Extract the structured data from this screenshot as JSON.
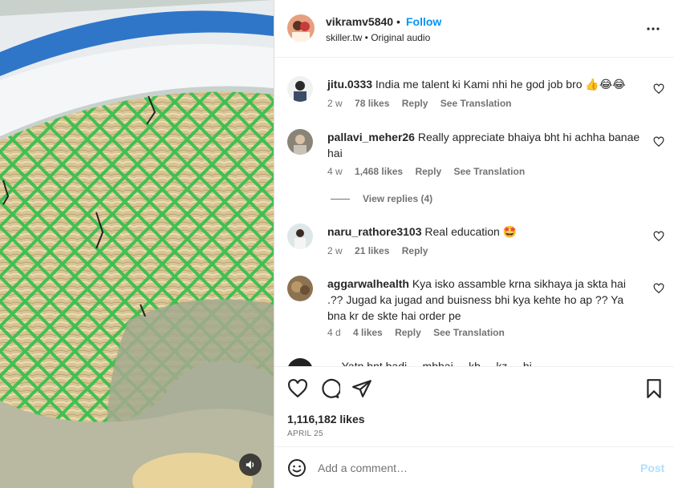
{
  "post": {
    "username": "vikramv5840",
    "separator": "•",
    "follow_label": "Follow",
    "subtitle": "skiller.tw • Original audio"
  },
  "comments": [
    {
      "username": "jitu.0333",
      "text": "India me talent ki Kami nhi he god job bro 👍😂😂",
      "time": "2 w",
      "likes": "78 likes",
      "reply": "Reply",
      "translate": "See Translation"
    },
    {
      "username": "pallavi_meher26",
      "text": "Really appreciate bhaiya bht hi achha banae hai",
      "time": "4 w",
      "likes": "1,468 likes",
      "reply": "Reply",
      "translate": "See Translation",
      "view_replies": "View replies (4)"
    },
    {
      "username": "naru_rathore3103",
      "text": "Real education 🤩",
      "time": "2 w",
      "likes": "21 likes",
      "reply": "Reply"
    },
    {
      "username": "aggarwalhealth",
      "text": "Kya isko assamble krna sikhaya ja skta hai .?? Jugad ka jugad and buisness bhi kya kehte ho ap ?? Ya bna kr de skte hai order pe",
      "time": "4 d",
      "likes": "4 likes",
      "reply": "Reply",
      "translate": "See Translation"
    }
  ],
  "partial_comment_text": "…  Yatn bnt badi  ... mbhai ... kb ... kz ... hi",
  "footer": {
    "likes": "1,116,182 likes",
    "date": "APRIL 25",
    "add_comment_placeholder": "Add a comment…",
    "post_label": "Post"
  },
  "icons": {
    "more": "more-horizontal-icon",
    "like": "heart-icon",
    "comment": "comment-bubble-icon",
    "share": "paper-plane-icon",
    "save": "bookmark-icon",
    "emoji": "emoji-smile-icon",
    "mute": "speaker-icon"
  },
  "colors": {
    "accent": "#0095f6",
    "post_disabled": "#b2dffc",
    "muted_text": "#737373"
  }
}
